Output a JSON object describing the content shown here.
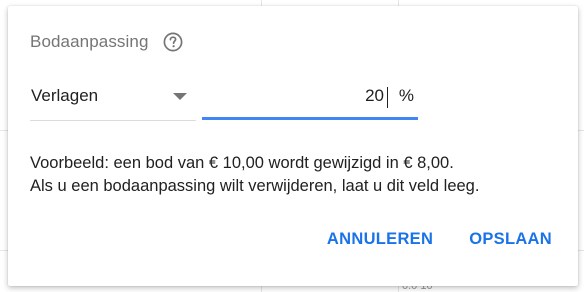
{
  "dialog": {
    "title": "Bodaanpassing",
    "help_icon": "help-circle-icon",
    "adjustment": {
      "selected": "Verlagen",
      "value": "20",
      "unit": "%"
    },
    "example_line1": "Voorbeeld: een bod van € 10,00 wordt gewijzigd in € 8,00.",
    "example_line2": "Als u een bodaanpassing wilt verwijderen, laat u dit veld leeg.",
    "buttons": {
      "cancel": "ANNULEREN",
      "save": "OPSLAAN"
    }
  },
  "background": {
    "cell_text": "0.0 10"
  },
  "colors": {
    "accent": "#4285f4",
    "button": "#1a73e8"
  }
}
